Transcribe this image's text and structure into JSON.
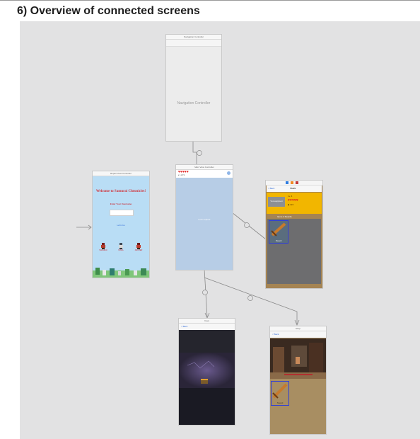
{
  "heading": "6) Overview of connected screens",
  "scenes": {
    "navigation": {
      "title": "Navigation Controller",
      "body_label": "Navigation Controller"
    },
    "welcome": {
      "title": "Repair View Controller",
      "welcome_text": "Welcome to Samurai Chronicles!",
      "prompt": "Enter Your Username",
      "button": "Let's Go",
      "characters": [
        "SAMURAI",
        "NINJA",
        "ARCHER"
      ]
    },
    "main": {
      "title": "Main View Controller",
      "hearts": "♥♥♥♥♥",
      "sub": "♦ 1.22 $",
      "center_label": "Let's explore"
    },
    "inventory": {
      "back": "< Back",
      "title": "TAGS",
      "stats": "Lv. 4",
      "hearts": "♥♥♥♥♥",
      "coins": "◆ 124",
      "badge": "Your equipment",
      "items_label": "Items 2 Swords",
      "sword_label": "Sword"
    },
    "cave": {
      "title": "Cave",
      "back": "< Back"
    },
    "shop": {
      "title": "Shop",
      "back": "< Back",
      "sword_label": "Sword"
    }
  },
  "colors": {
    "canvas": "#e2e2e3",
    "main_scene": "#b7cde6",
    "welcome_sky": "#b9ddf5",
    "inventory_gold": "#f2b600",
    "inventory_gray": "#6d6d6f",
    "frame_brown": "#a58453",
    "shop_sand": "#a88e62",
    "selection_blue": "#2f3fd6"
  }
}
